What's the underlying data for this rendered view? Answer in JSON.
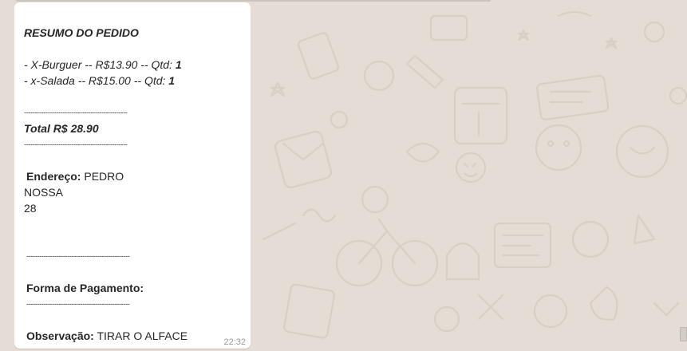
{
  "message": {
    "title": "RESUMO DO PEDIDO",
    "items": [
      {
        "prefix": "-  X-Burguer -- R$13.90 -- Qtd: ",
        "qty": "1"
      },
      {
        "prefix": "-  x-Salada -- R$15.00 -- Qtd: ",
        "qty": "1"
      }
    ],
    "separator": "------------------------------------------------",
    "total": "Total R$ 28.90",
    "address_label": "Endereço:",
    "address_name": "PEDRO",
    "address_line2": "NOSSA",
    "address_line3": "28",
    "payment_label": "Forma de Pagamento:",
    "observation_label": "Observação:",
    "observation_value": "TIRAR O ALFACE",
    "timestamp": "22:32"
  },
  "colors": {
    "chat_background": "#e5ddd5",
    "bubble_background": "#ffffff",
    "text": "#262626",
    "timestamp": "#999999"
  }
}
